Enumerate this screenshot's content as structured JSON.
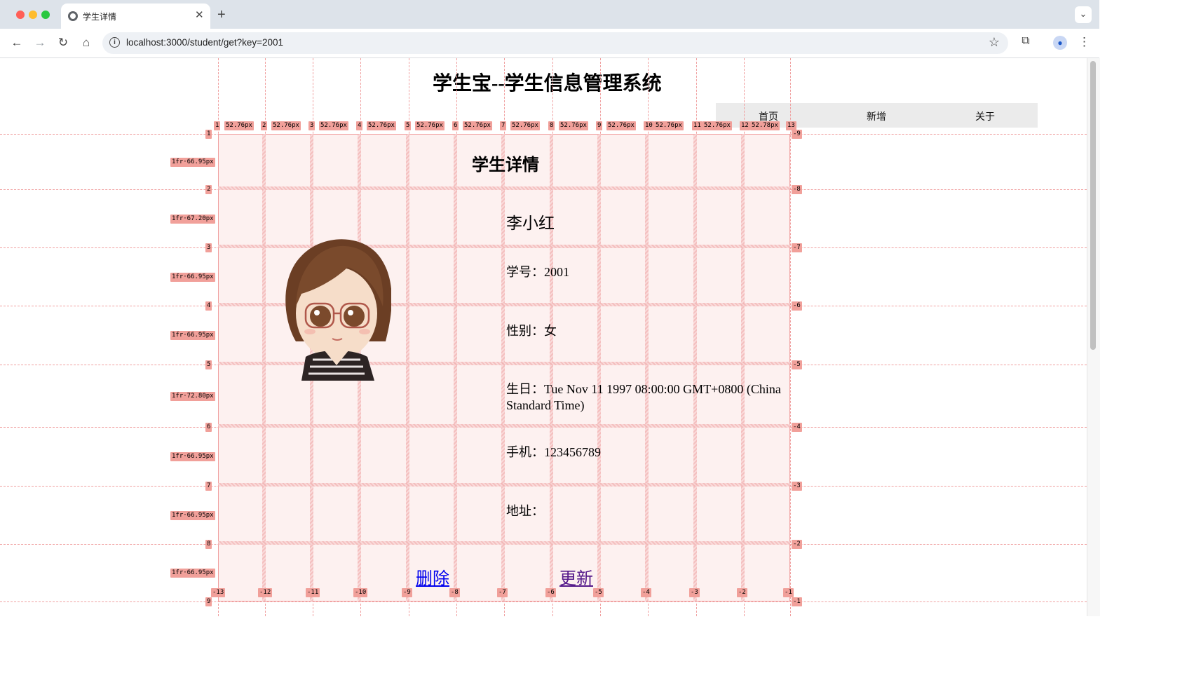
{
  "browser": {
    "tab_title": "学生详情",
    "tab_close": "✕",
    "new_tab": "+",
    "tab_dropdown": "⌄",
    "url": "localhost:3000/student/get?key=2001",
    "icons": {
      "back": "←",
      "forward": "→",
      "reload": "↻",
      "home": "⌂",
      "site_info": "i",
      "bookmark": "☆",
      "extensions": "⧉",
      "profile": "●",
      "menu": "⋮"
    },
    "traffic_colors": [
      "#ff5f57",
      "#febc2e",
      "#28c840"
    ]
  },
  "page": {
    "app_title": "学生宝--学生信息管理系统",
    "nav": [
      "首页",
      "新增",
      "关于"
    ],
    "detail_title": "学生详情",
    "student": {
      "name": "李小红",
      "id_line": "学号：2001",
      "gender_line": "性别：女",
      "birthday_line": "生日：Tue Nov 11 1997 08:00:00 GMT+0800 (China Standard Time)",
      "phone_line": "手机：123456789",
      "address_line": "地址："
    },
    "actions": {
      "delete": "删除",
      "update": "更新"
    },
    "link_colors": {
      "link": "#0000ee",
      "visited": "#551a8b"
    }
  },
  "grid_overlay": {
    "column_numbers": [
      "1",
      "2",
      "3",
      "4",
      "5",
      "6",
      "7",
      "8",
      "9",
      "10",
      "11",
      "12",
      "13"
    ],
    "column_sizes": [
      "52.76px",
      "52.76px",
      "52.76px",
      "52.76px",
      "52.76px",
      "52.76px",
      "52.76px",
      "52.76px",
      "52.76px",
      "52.76px",
      "52.76px",
      "52.78px"
    ],
    "column_negative_numbers": [
      "-13",
      "-12",
      "-11",
      "-10",
      "-9",
      "-8",
      "-7",
      "-6",
      "-5",
      "-4",
      "-3",
      "-2",
      "-1"
    ],
    "row_numbers": [
      "1",
      "2",
      "3",
      "4",
      "5",
      "6",
      "7",
      "8",
      "9"
    ],
    "row_sizes": [
      "1fr·66.95px",
      "1fr·67.20px",
      "1fr·66.95px",
      "1fr·66.95px",
      "1fr·72.80px",
      "1fr·66.95px",
      "1fr·66.95px",
      "1fr·66.95px"
    ],
    "row_negative_numbers": [
      "-9",
      "-8",
      "-7",
      "-6",
      "-5",
      "-4",
      "-3",
      "-2",
      "-1"
    ]
  }
}
